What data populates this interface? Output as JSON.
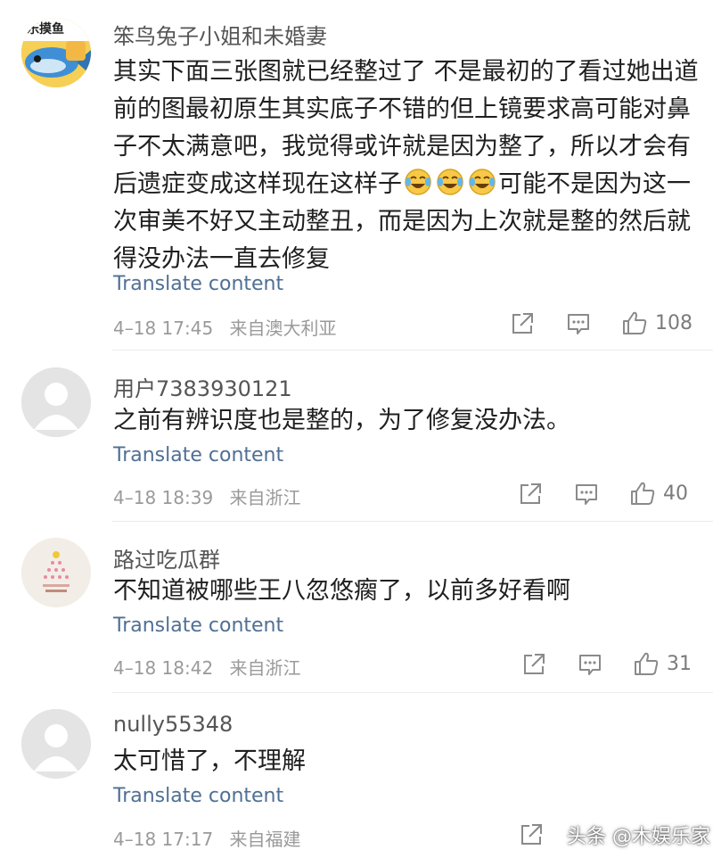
{
  "comments": [
    {
      "username": "笨鸟兔子小姐和未婚妻",
      "avatar_label": "乐摸鱼",
      "text_parts": [
        "其实下面三张图就已经整过了 不是最初的了看过她出道前的图最初原生其实底子不错的但上镜要求高可能对鼻子不太满意吧，我觉得或许就是因为整了，所以才会有后遗症变成这样现在这样子",
        "可能不是因为这一次审美不好又主动整丑，而是因为上次就是整的然后就得没办法一直去修复"
      ],
      "emoji_icons": [
        "laugh-cry-emoji",
        "laugh-cry-emoji",
        "laugh-cry-emoji"
      ],
      "translate": "Translate content",
      "time": "4–18 17:45",
      "location": "来自澳大利亚",
      "likes": "108"
    },
    {
      "username": "用户7383930121",
      "text": "之前有辨识度也是整的，为了修复没办法。",
      "translate": "Translate content",
      "time": "4–18 18:39",
      "location": "来自浙江",
      "likes": "40"
    },
    {
      "username": "路过吃瓜群",
      "text": "不知道被哪些王八忽悠瘸了，以前多好看啊",
      "translate": "Translate content",
      "time": "4–18 18:42",
      "location": "来自浙江",
      "likes": "31"
    },
    {
      "username": "nully55348",
      "text": "太可惜了，不理解",
      "translate": "Translate content",
      "time": "4–18 17:17",
      "location": "来自福建",
      "likes": ""
    }
  ],
  "icons": {
    "share": "share-icon",
    "reply": "comment-icon",
    "like": "thumbs-up-icon"
  },
  "colors": {
    "link": "#4f6f93",
    "meta": "#9a9a9a",
    "icon": "#8a8a8a"
  },
  "watermark": "头条 @木娱乐家"
}
